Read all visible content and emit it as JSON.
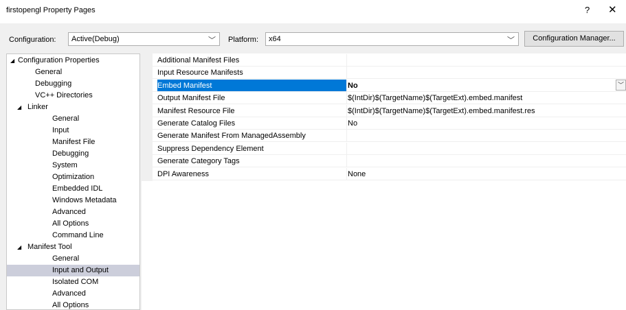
{
  "window": {
    "title": "firstopengl Property Pages",
    "help": "?",
    "close": "✕"
  },
  "toolbar": {
    "configuration_label": "Configuration:",
    "configuration_value": "Active(Debug)",
    "platform_label": "Platform:",
    "platform_value": "x64",
    "config_manager": "Configuration Manager..."
  },
  "tree": [
    {
      "label": "Configuration Properties",
      "level": 0,
      "expander": "◢"
    },
    {
      "label": "General",
      "level": 1
    },
    {
      "label": "Debugging",
      "level": 1
    },
    {
      "label": "VC++ Directories",
      "level": 1
    },
    {
      "label": "Linker",
      "level": 1,
      "expander": "◢"
    },
    {
      "label": "General",
      "level": 2
    },
    {
      "label": "Input",
      "level": 2
    },
    {
      "label": "Manifest File",
      "level": 2
    },
    {
      "label": "Debugging",
      "level": 2
    },
    {
      "label": "System",
      "level": 2
    },
    {
      "label": "Optimization",
      "level": 2
    },
    {
      "label": "Embedded IDL",
      "level": 2
    },
    {
      "label": "Windows Metadata",
      "level": 2
    },
    {
      "label": "Advanced",
      "level": 2
    },
    {
      "label": "All Options",
      "level": 2
    },
    {
      "label": "Command Line",
      "level": 2
    },
    {
      "label": "Manifest Tool",
      "level": 1,
      "expander": "◢"
    },
    {
      "label": "General",
      "level": 2
    },
    {
      "label": "Input and Output",
      "level": 2,
      "selected": true
    },
    {
      "label": "Isolated COM",
      "level": 2
    },
    {
      "label": "Advanced",
      "level": 2
    },
    {
      "label": "All Options",
      "level": 2
    }
  ],
  "properties": [
    {
      "name": "Additional Manifest Files",
      "value": ""
    },
    {
      "name": "Input Resource Manifests",
      "value": ""
    },
    {
      "name": "Embed Manifest",
      "value": "No",
      "selected": true,
      "dropdown": "﹀"
    },
    {
      "name": "Output Manifest File",
      "value": "$(IntDir)$(TargetName)$(TargetExt).embed.manifest"
    },
    {
      "name": "Manifest Resource File",
      "value": "$(IntDir)$(TargetName)$(TargetExt).embed.manifest.res"
    },
    {
      "name": "Generate Catalog Files",
      "value": "No"
    },
    {
      "name": "Generate Manifest From ManagedAssembly",
      "value": ""
    },
    {
      "name": "Suppress Dependency Element",
      "value": ""
    },
    {
      "name": "Generate Category Tags",
      "value": ""
    },
    {
      "name": "DPI Awareness",
      "value": "None"
    }
  ],
  "colors": {
    "selection": "#0078d7",
    "tree_selection": "#cccedb"
  }
}
